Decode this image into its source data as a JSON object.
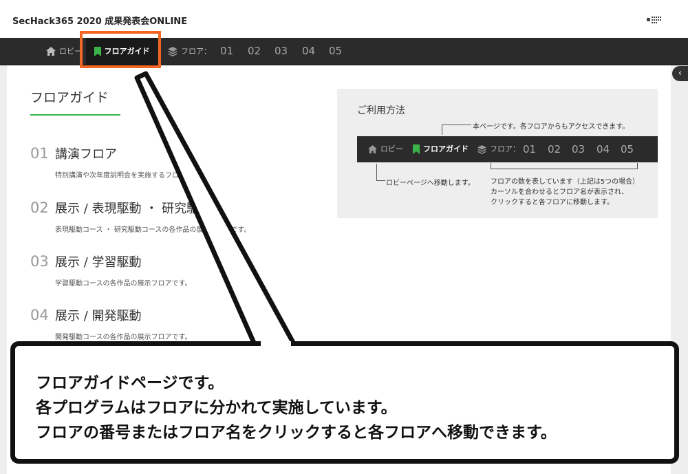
{
  "header": {
    "title": "SecHack365 2020 成果発表会ONLINE"
  },
  "nav": {
    "lobby_label": "ロビー",
    "guide_label": "フロアガイド",
    "floor_label": "フロア：",
    "floors": [
      "01",
      "02",
      "03",
      "04",
      "05"
    ]
  },
  "page": {
    "heading": "フロアガイド",
    "floors": [
      {
        "num": "01",
        "name": "講演フロア",
        "desc": "特別講演や次年度説明会を実施するフロアです。"
      },
      {
        "num": "02",
        "name": "展示 / 表現駆動 ・ 研究駆動",
        "desc": "表現駆動コース ・ 研究駆動コースの各作品の展示フロアです。"
      },
      {
        "num": "03",
        "name": "展示 / 学習駆動",
        "desc": "学習駆動コースの各作品の展示フロアです。"
      },
      {
        "num": "04",
        "name": "展示 / 開発駆動",
        "desc": "開発駆動コースの各作品の展示フロアです。"
      }
    ]
  },
  "help": {
    "title": "ご利用方法",
    "note_top": "本ページです。各フロアからもアクセスできます。",
    "note_left": "ロビーページへ移動します。",
    "note_right": [
      "フロアの数を表しています（上記は5つの場合）",
      "カーソルを合わせるとフロア名が表示され、",
      "クリックすると各フロアに移動します。"
    ]
  },
  "callout": {
    "lines": [
      "フロアガイドページです。",
      "各プログラムはフロアに分かれて実施しています。",
      "フロアの番号またはフロア名をクリックすると各フロアへ移動できます。"
    ]
  },
  "colors": {
    "accent_green": "#3bb54a",
    "highlight_orange": "#f26522",
    "nav_bg": "#2b2b2b"
  },
  "icons": [
    "home-icon",
    "bookmark-icon",
    "layers-icon",
    "chevron-left-icon"
  ]
}
